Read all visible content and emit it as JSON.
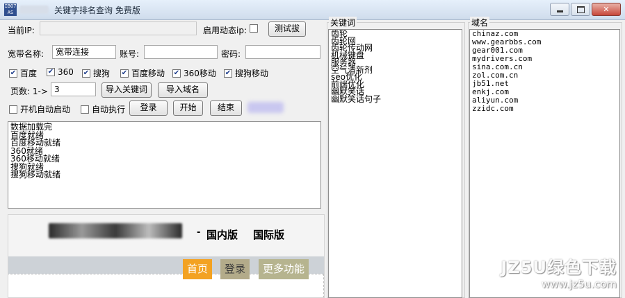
{
  "window": {
    "title": "关键字排名查询 免费版",
    "icon_text": "IBO7 AS",
    "buttons": [
      "minimize",
      "maximize",
      "close"
    ]
  },
  "form": {
    "current_ip_label": "当前IP:",
    "current_ip_value": "",
    "dynamic_ip_label": "启用动态ip:",
    "dynamic_ip_checked": false,
    "test_dial_button": "测试拔",
    "broadband_name_label": "宽带名称:",
    "broadband_name_value": "宽带连接",
    "account_label": "账号:",
    "account_value": "",
    "password_label": "密码:",
    "password_value": "",
    "engines": [
      {
        "label": "百度",
        "checked": true
      },
      {
        "label": "360",
        "checked": true
      },
      {
        "label": "搜狗",
        "checked": true
      },
      {
        "label": "百度移动",
        "checked": true
      },
      {
        "label": "360移动",
        "checked": true
      },
      {
        "label": "搜狗移动",
        "checked": true
      }
    ],
    "pages_label": "页数: 1->",
    "pages_value": "3",
    "import_keywords_button": "导入关键词",
    "import_domains_button": "导入域名",
    "autostart_label": "开机自动启动",
    "autostart_checked": false,
    "autorun_label": "自动执行",
    "autorun_checked": false,
    "login_button": "登录",
    "start_button": "开始",
    "end_button": "结束"
  },
  "log": {
    "lines": [
      "数据加载完",
      "百度就绪",
      "百度移动就绪",
      "360就绪",
      "360移动就绪",
      "搜狗就绪",
      "搜狗移动就绪"
    ]
  },
  "browser": {
    "separator": "-",
    "domestic_label": "国内版",
    "international_label": "国际版",
    "nav": {
      "home": "首页",
      "login": "登录",
      "more": "更多功能"
    }
  },
  "keywords": {
    "title": "关键词",
    "items": [
      "齿轮",
      "齿轮网",
      "齿轮传动网",
      "机械键盘",
      "服务器",
      "空气清新剂",
      "seo优化",
      "前端优化",
      "幽默笑话",
      "幽默笑话句子"
    ]
  },
  "domains": {
    "title": "域名",
    "items": [
      "chinaz.com",
      "www.gearbbs.com",
      "gear001.com",
      "mydrivers.com",
      "sina.com.cn",
      "zol.com.cn",
      "jb51.net",
      "enkj.com",
      "aliyun.com",
      "zzidc.com"
    ]
  },
  "watermark": {
    "main": "JZ5U绿色下载",
    "url": "www.jz5u.com"
  },
  "colors": {
    "home_nav": "#f3a222",
    "login_nav": "#b3ab8a",
    "more_nav": "#b6b48f",
    "checkbox_check": "#1b3b8a"
  }
}
